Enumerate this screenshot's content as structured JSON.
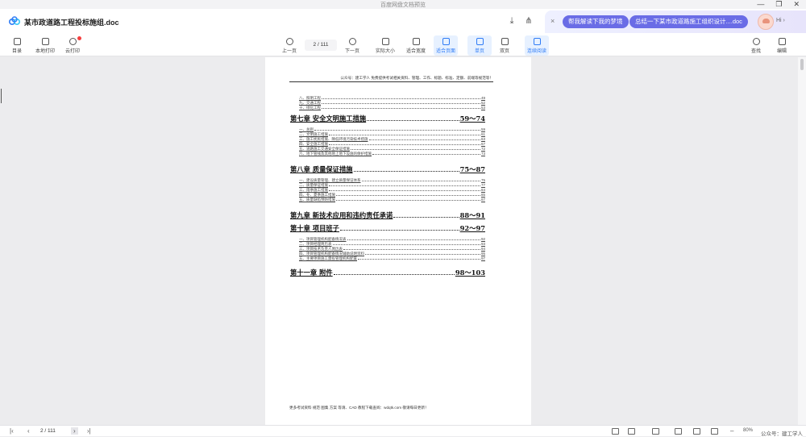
{
  "window": {
    "title": "百度网盘文档预览",
    "min_icon": "minimize-icon",
    "restore_icon": "restore-icon",
    "close_icon": "close-icon"
  },
  "topbar": {
    "doc_title": "某市政道路工程投标施组.doc",
    "logo_icon": "baidu-netdisk-logo-icon",
    "download_icon": "download-icon",
    "share_icon": "share-icon"
  },
  "ai_panel": {
    "close_label": "×",
    "pill_1": "帮我解读下我的梦境",
    "pill_2": "总结一下某市政道路施工组织设计....doc",
    "greeting": "Hi ›"
  },
  "toolbar": {
    "left": [
      {
        "label": "目录",
        "icon": "toc-icon"
      },
      {
        "label": "本地打印",
        "icon": "print-icon"
      },
      {
        "label": "云打印",
        "icon": "cloud-print-icon"
      }
    ],
    "prev_label": "上一页",
    "page_indicator": "2  /  111",
    "next_label": "下一页",
    "view_modes": [
      {
        "label": "实际大小",
        "icon": "actual-size-icon",
        "active": false
      },
      {
        "label": "适合宽度",
        "icon": "fit-width-icon",
        "active": false
      },
      {
        "label": "适合页面",
        "icon": "fit-page-icon",
        "active": true
      },
      {
        "label": "单页",
        "icon": "single-page-icon",
        "active": true
      },
      {
        "label": "双页",
        "icon": "double-page-icon",
        "active": false
      },
      {
        "label": "连续阅读",
        "icon": "continuous-read-icon",
        "active": true
      }
    ],
    "search_label": "查找",
    "edit_label": "编辑"
  },
  "document": {
    "header": "公众号：建工学人 免费提供考试相关资料、管理、工作、标题、标准、定额、前端等规范等！",
    "toc": [
      {
        "kind": "sub",
        "title": "八、照明工程",
        "page": "49"
      },
      {
        "kind": "sub",
        "title": "九、交通工程",
        "page": "52"
      },
      {
        "kind": "sub",
        "title": "十、绿化工程",
        "page": "53"
      },
      {
        "kind": "chapter",
        "title": "第七章  安全文明施工措施",
        "page": "59～74"
      },
      {
        "kind": "sub",
        "title": "一、总则",
        "page": "59"
      },
      {
        "kind": "sub",
        "title": "二、文明施工措施",
        "page": "61"
      },
      {
        "kind": "sub",
        "title": "三、施工扰民措施、降低环境污染技术措施",
        "page": "63"
      },
      {
        "kind": "sub",
        "title": "四、安全施工措施",
        "page": "67"
      },
      {
        "kind": "sub",
        "title": "五、道路施工交通安全保证措施",
        "page": "72"
      },
      {
        "kind": "sub",
        "title": "六、地下管线及其他地上地下设施的保护措施",
        "page": "73"
      },
      {
        "kind": "chapter",
        "title": "第八章  质量保证措施",
        "page": "75～87"
      },
      {
        "kind": "sub",
        "title": "一、建设质量管理、建立质量保证体系",
        "page": "75"
      },
      {
        "kind": "sub",
        "title": "二、质量保证措施",
        "page": "77"
      },
      {
        "kind": "sub",
        "title": "三、雨季施工措施",
        "page": "84"
      },
      {
        "kind": "sub",
        "title": "四、冬、夏季施工措施",
        "page": "85"
      },
      {
        "kind": "sub",
        "title": "五、质量缺陷预防措施",
        "page": "87"
      },
      {
        "kind": "chapter",
        "title": "第九章  新技术应用和违约责任承诺",
        "page": "88～91"
      },
      {
        "kind": "chapter",
        "title": "第十章  项目班子",
        "page": "92～97"
      },
      {
        "kind": "sub",
        "title": "一、项目管理机构配备情况表",
        "page": "92"
      },
      {
        "kind": "sub",
        "title": "二、项目经理简历表",
        "page": "93"
      },
      {
        "kind": "sub",
        "title": "三、项目技术负责人简历表",
        "page": "94"
      },
      {
        "kind": "sub",
        "title": "四、项目管理机构配备情况辅助说明资料",
        "page": "95"
      },
      {
        "kind": "sub",
        "title": "五、主要项目施工需投管理机构配置",
        "page": "97"
      },
      {
        "kind": "chapter",
        "title": "第十一章  附件",
        "page": "98～103"
      }
    ],
    "footer": "更多考试资料 规范 图集 方案 等请、CAD 教程下载查阅：wdqtk.com 敬请每日更新！"
  },
  "statusbar": {
    "first_icon": "first-page-icon",
    "prev_icon": "prev-page-icon",
    "page": "2  /  111",
    "next_icon": "next-page-icon",
    "last_icon": "last-page-icon",
    "zoom": "80%",
    "watermark": "公众号：建工学人"
  }
}
